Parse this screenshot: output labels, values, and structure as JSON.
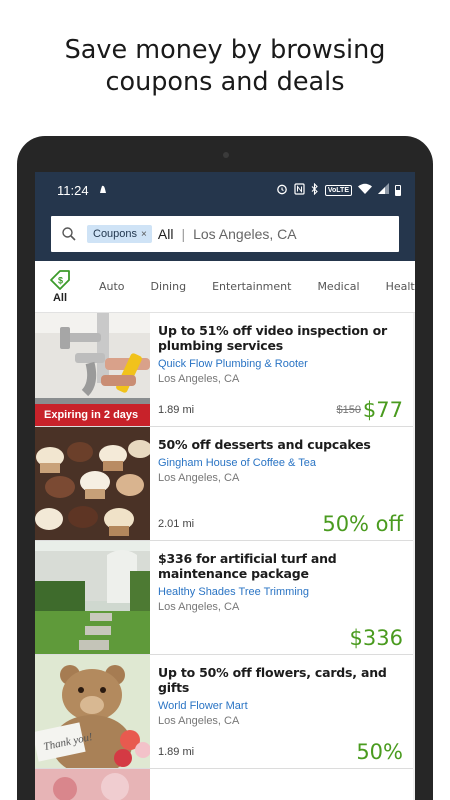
{
  "headline": {
    "line1": "Save money by browsing",
    "line2": "coupons and deals"
  },
  "statusbar": {
    "time": "11:24",
    "network_label": "VoLTE"
  },
  "search": {
    "chip_label": "Coupons",
    "chip_close": "×",
    "scope": "All",
    "separator": "|",
    "location": "Los Angeles, CA"
  },
  "categories": {
    "all_label": "All",
    "items": [
      "Auto",
      "Dining",
      "Entertainment",
      "Medical",
      "Healt"
    ]
  },
  "deals": [
    {
      "title": "Up to 51% off video inspection or plumbing services",
      "merchant": "Quick Flow Plumbing & Rooter",
      "city": "Los Angeles, CA",
      "distance": "1.89 mi",
      "original_price": "$150",
      "price": "$77",
      "badge": "Expiring in 2 days"
    },
    {
      "title": "50% off desserts and cupcakes",
      "merchant": "Gingham House of Coffee & Tea",
      "city": "Los Angeles, CA",
      "distance": "2.01 mi",
      "price": "50% off"
    },
    {
      "title": "$336 for artificial turf and maintenance package",
      "merchant": "Healthy Shades Tree Trimming",
      "city": "Los Angeles, CA",
      "distance": "",
      "price": "$336"
    },
    {
      "title": "Up to 50% off flowers, cards, and gifts",
      "merchant": "World Flower Mart",
      "city": "Los Angeles, CA",
      "distance": "1.89 mi",
      "price": "50%"
    }
  ],
  "colors": {
    "header_bg": "#25364c",
    "price_green": "#4a9b1f",
    "merchant_blue": "#2a74c4",
    "expire_red": "#c8222a"
  }
}
